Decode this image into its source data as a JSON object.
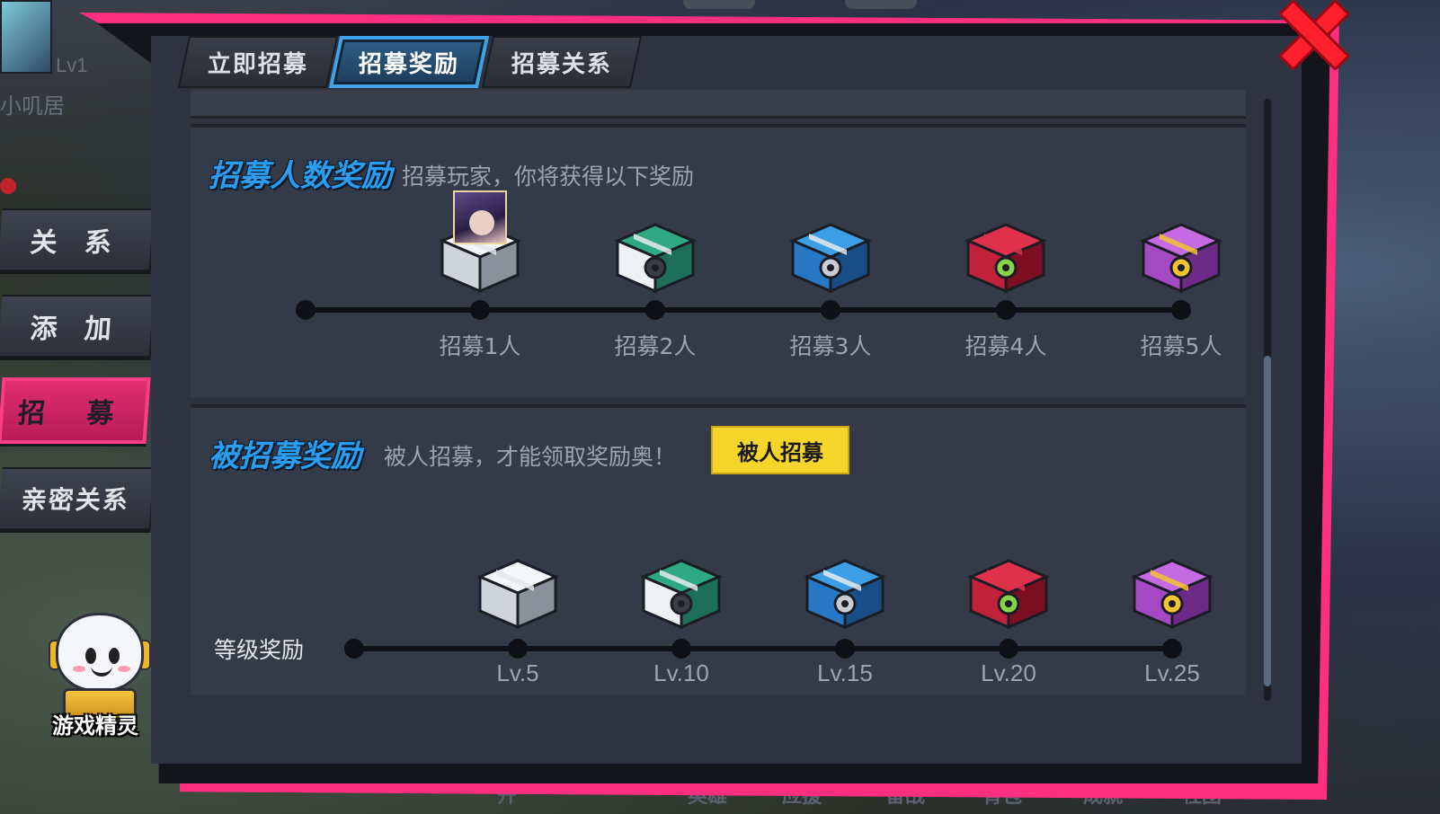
{
  "background": {
    "player_level": "Lv1",
    "player_name": "小叽居",
    "bottom_nav": [
      "开",
      "英雄",
      "应援",
      "备战",
      "背包",
      "成就",
      "社团"
    ]
  },
  "side_menu": {
    "items": [
      {
        "label": "关 系",
        "active": false
      },
      {
        "label": "添 加",
        "active": false
      },
      {
        "label": "招 募",
        "active": true
      },
      {
        "label": "亲密关系",
        "active": false
      }
    ]
  },
  "sprite": {
    "label": "游戏精灵"
  },
  "tabs": [
    {
      "label": "立即招募",
      "active": false
    },
    {
      "label": "招募奖励",
      "active": true
    },
    {
      "label": "招募关系",
      "active": false
    }
  ],
  "recruit_count_section": {
    "title": "招募人数奖励",
    "subtitle": "招募玩家，你将获得以下奖励",
    "rewards": [
      {
        "label": "招募1人",
        "chest": "white-chest-icon"
      },
      {
        "label": "招募2人",
        "chest": "green-chest-icon"
      },
      {
        "label": "招募3人",
        "chest": "blue-chest-icon"
      },
      {
        "label": "招募4人",
        "chest": "red-chest-icon"
      },
      {
        "label": "招募5人",
        "chest": "purple-chest-icon"
      }
    ]
  },
  "recruited_section": {
    "title": "被招募奖励",
    "subtitle": "被人招募，才能领取奖励奥！",
    "button_label": "被人招募",
    "track_label": "等级奖励",
    "rewards": [
      {
        "label": "Lv.5",
        "chest": "white-chest-icon"
      },
      {
        "label": "Lv.10",
        "chest": "green-chest-icon"
      },
      {
        "label": "Lv.15",
        "chest": "blue-chest-icon"
      },
      {
        "label": "Lv.20",
        "chest": "red-chest-icon"
      },
      {
        "label": "Lv.25",
        "chest": "purple-chest-icon"
      }
    ]
  },
  "colors": {
    "accent_pink": "#ff2f80",
    "title_blue": "#2a9df0",
    "button_yellow": "#f6d52a",
    "close_red": "#ff1f2d"
  }
}
